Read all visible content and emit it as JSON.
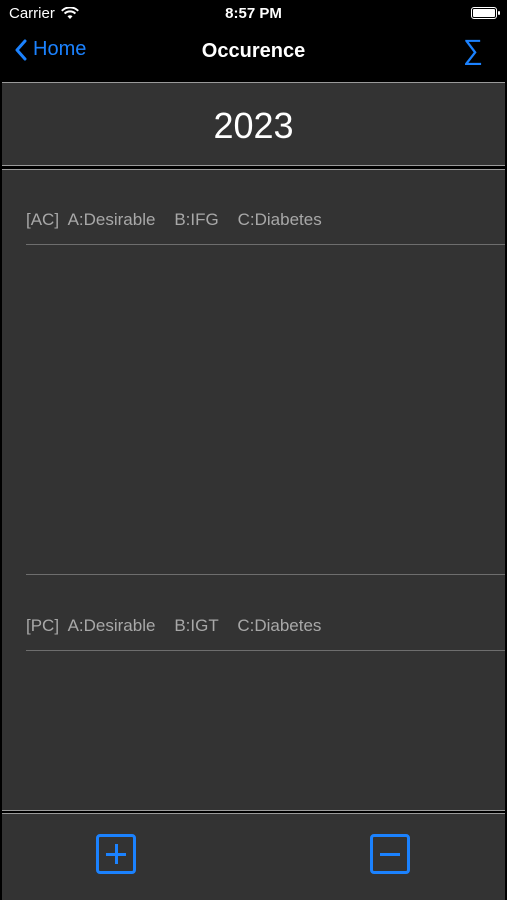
{
  "status_bar": {
    "carrier": "Carrier",
    "time": "8:57 PM"
  },
  "nav": {
    "back_label": "Home",
    "title": "Occurence",
    "sum_icon": "∑"
  },
  "year": "2023",
  "sections": {
    "ac_label": "[AC]  A:Desirable    B:IFG    C:Diabetes",
    "pc_label": "[PC]  A:Desirable    B:IGT    C:Diabetes"
  },
  "colors": {
    "accent": "#1b82ff",
    "panel": "#333333",
    "label": "#a8a8a8"
  }
}
